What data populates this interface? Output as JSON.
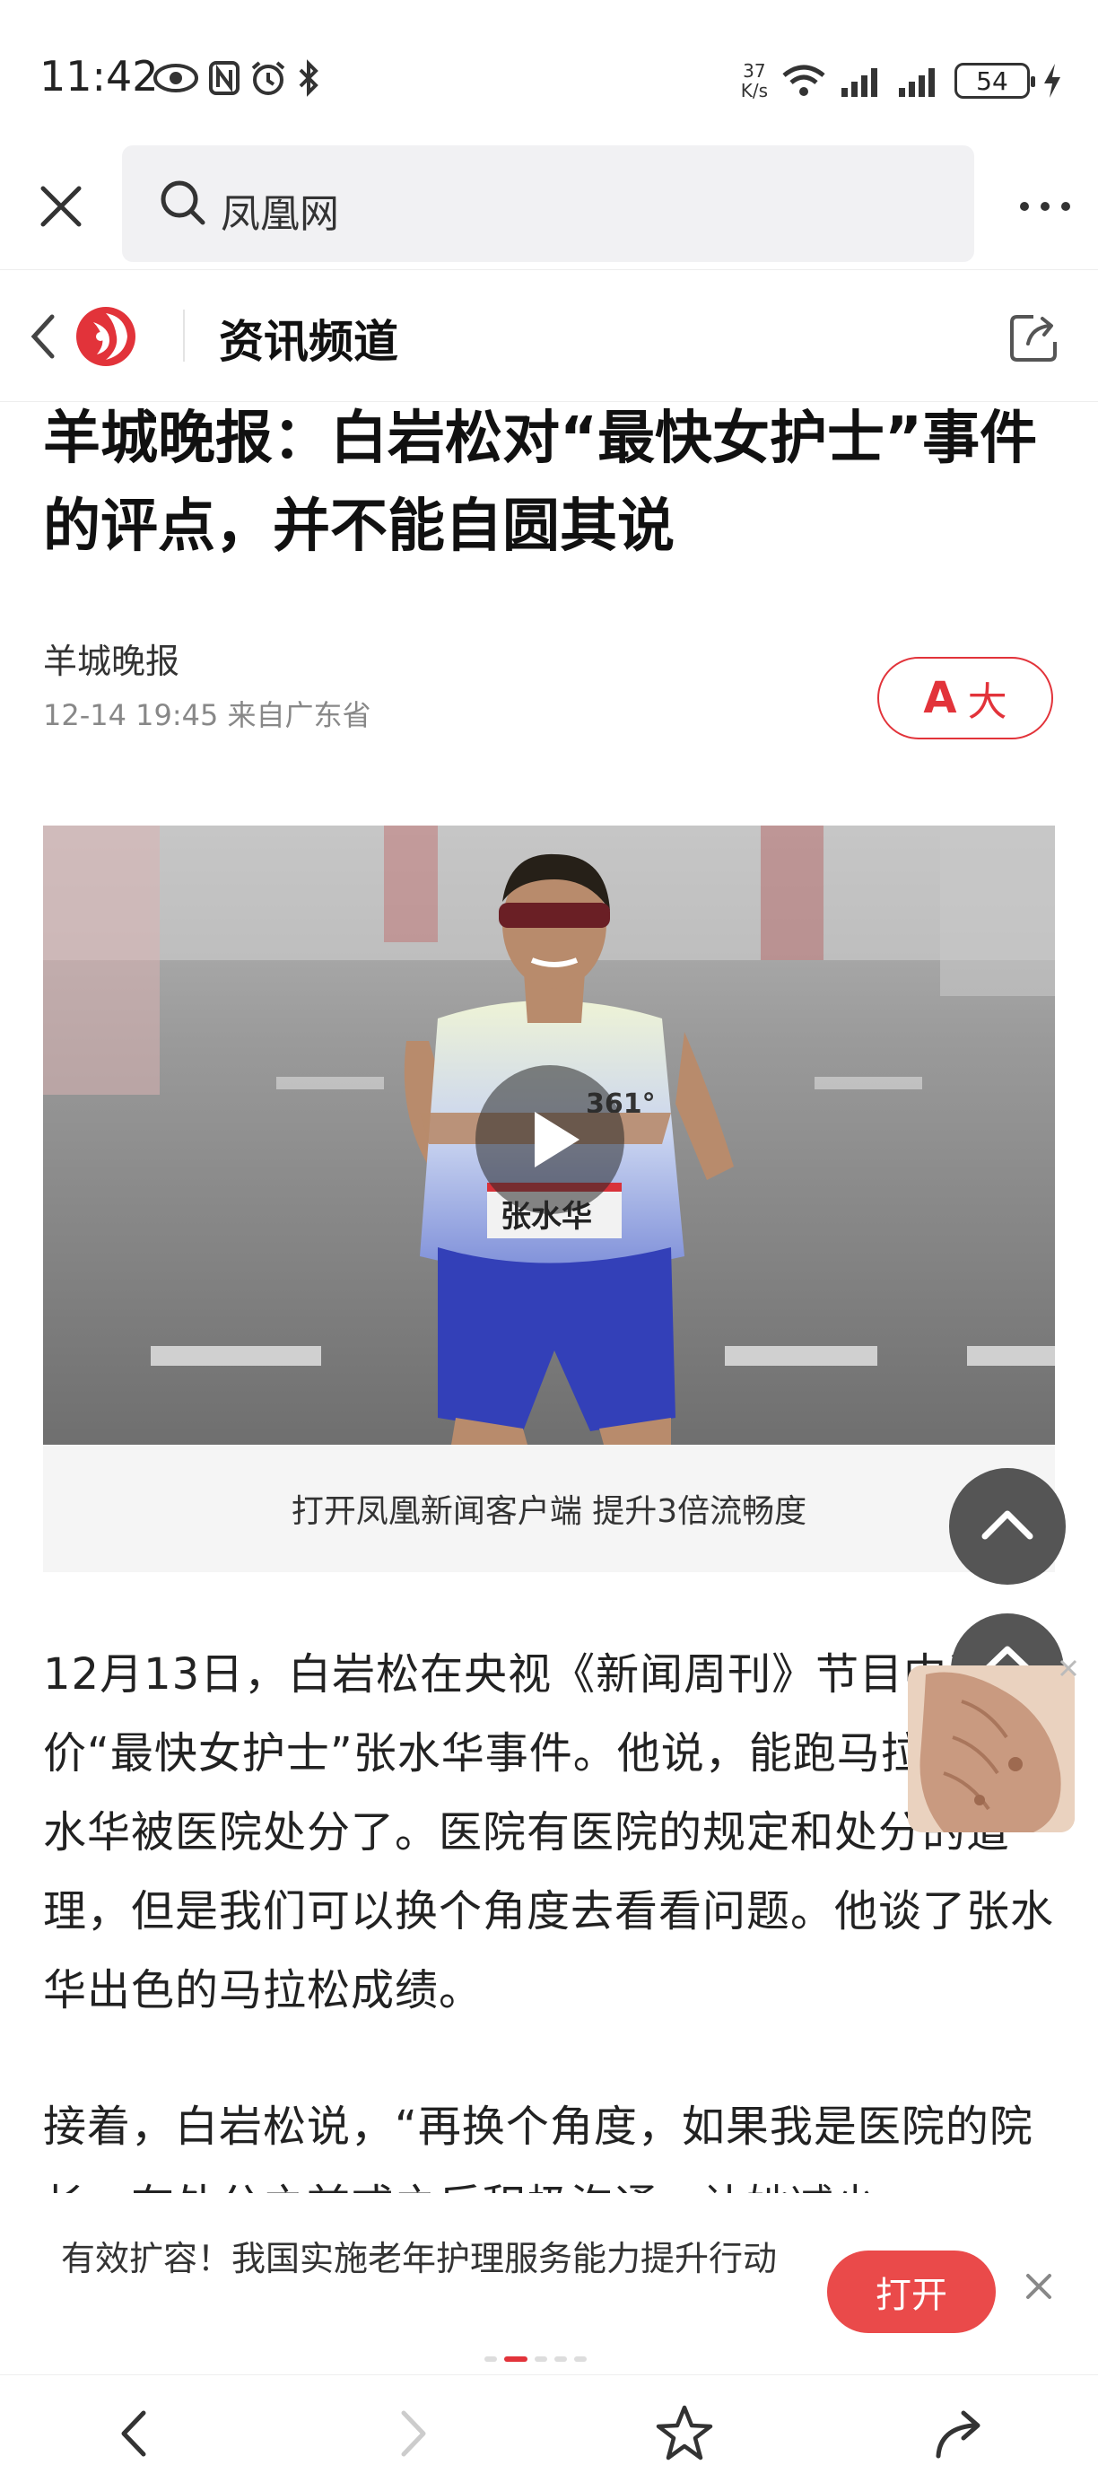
{
  "status_bar": {
    "time": "11:42",
    "net_speed_value": "37",
    "net_speed_unit": "K/s",
    "battery": "54",
    "icons": [
      "eye-icon",
      "nfc-icon",
      "alarm-icon",
      "bluetooth-icon",
      "wifi-icon",
      "signal-icon",
      "signal-icon",
      "battery-icon",
      "charging-icon"
    ]
  },
  "browser": {
    "search_text": "凤凰网"
  },
  "site_header": {
    "channel": "资讯频道"
  },
  "article": {
    "title": "羊城晚报：白岩松对“最快女护士”事件的评点，并不能自圆其说",
    "source": "羊城晚报",
    "meta": "12-14 19:45 来自广东省",
    "font_button_label": "大",
    "font_button_icon_text": "A",
    "video_jersey_name": "张水华",
    "video_bib_number": "361°",
    "video_caption": "打开凤凰新闻客户端 提升3倍流畅度",
    "paragraph1": "12月13日，白岩松在央视《新闻周刊》节目中评价“最快女护士”张水华事件。他说，能跑马拉松的张水华被医院处分了。医院有医院的规定和处分的道理，但是我们可以换个角度去看看问题。他谈了张水华出色的马拉松成绩。",
    "paragraph2": "接着，白岩松说，“再换个角度，如果我是医院的院长，在处分之前或之后积极沟通，让她减少"
  },
  "banner": {
    "text": "有效扩容！我国实施老年护理服务能力提升行动",
    "open_label": "打开"
  },
  "colors": {
    "accent": "#e2333a",
    "open_button": "#ea4a4a",
    "floating_button": "#555555"
  }
}
